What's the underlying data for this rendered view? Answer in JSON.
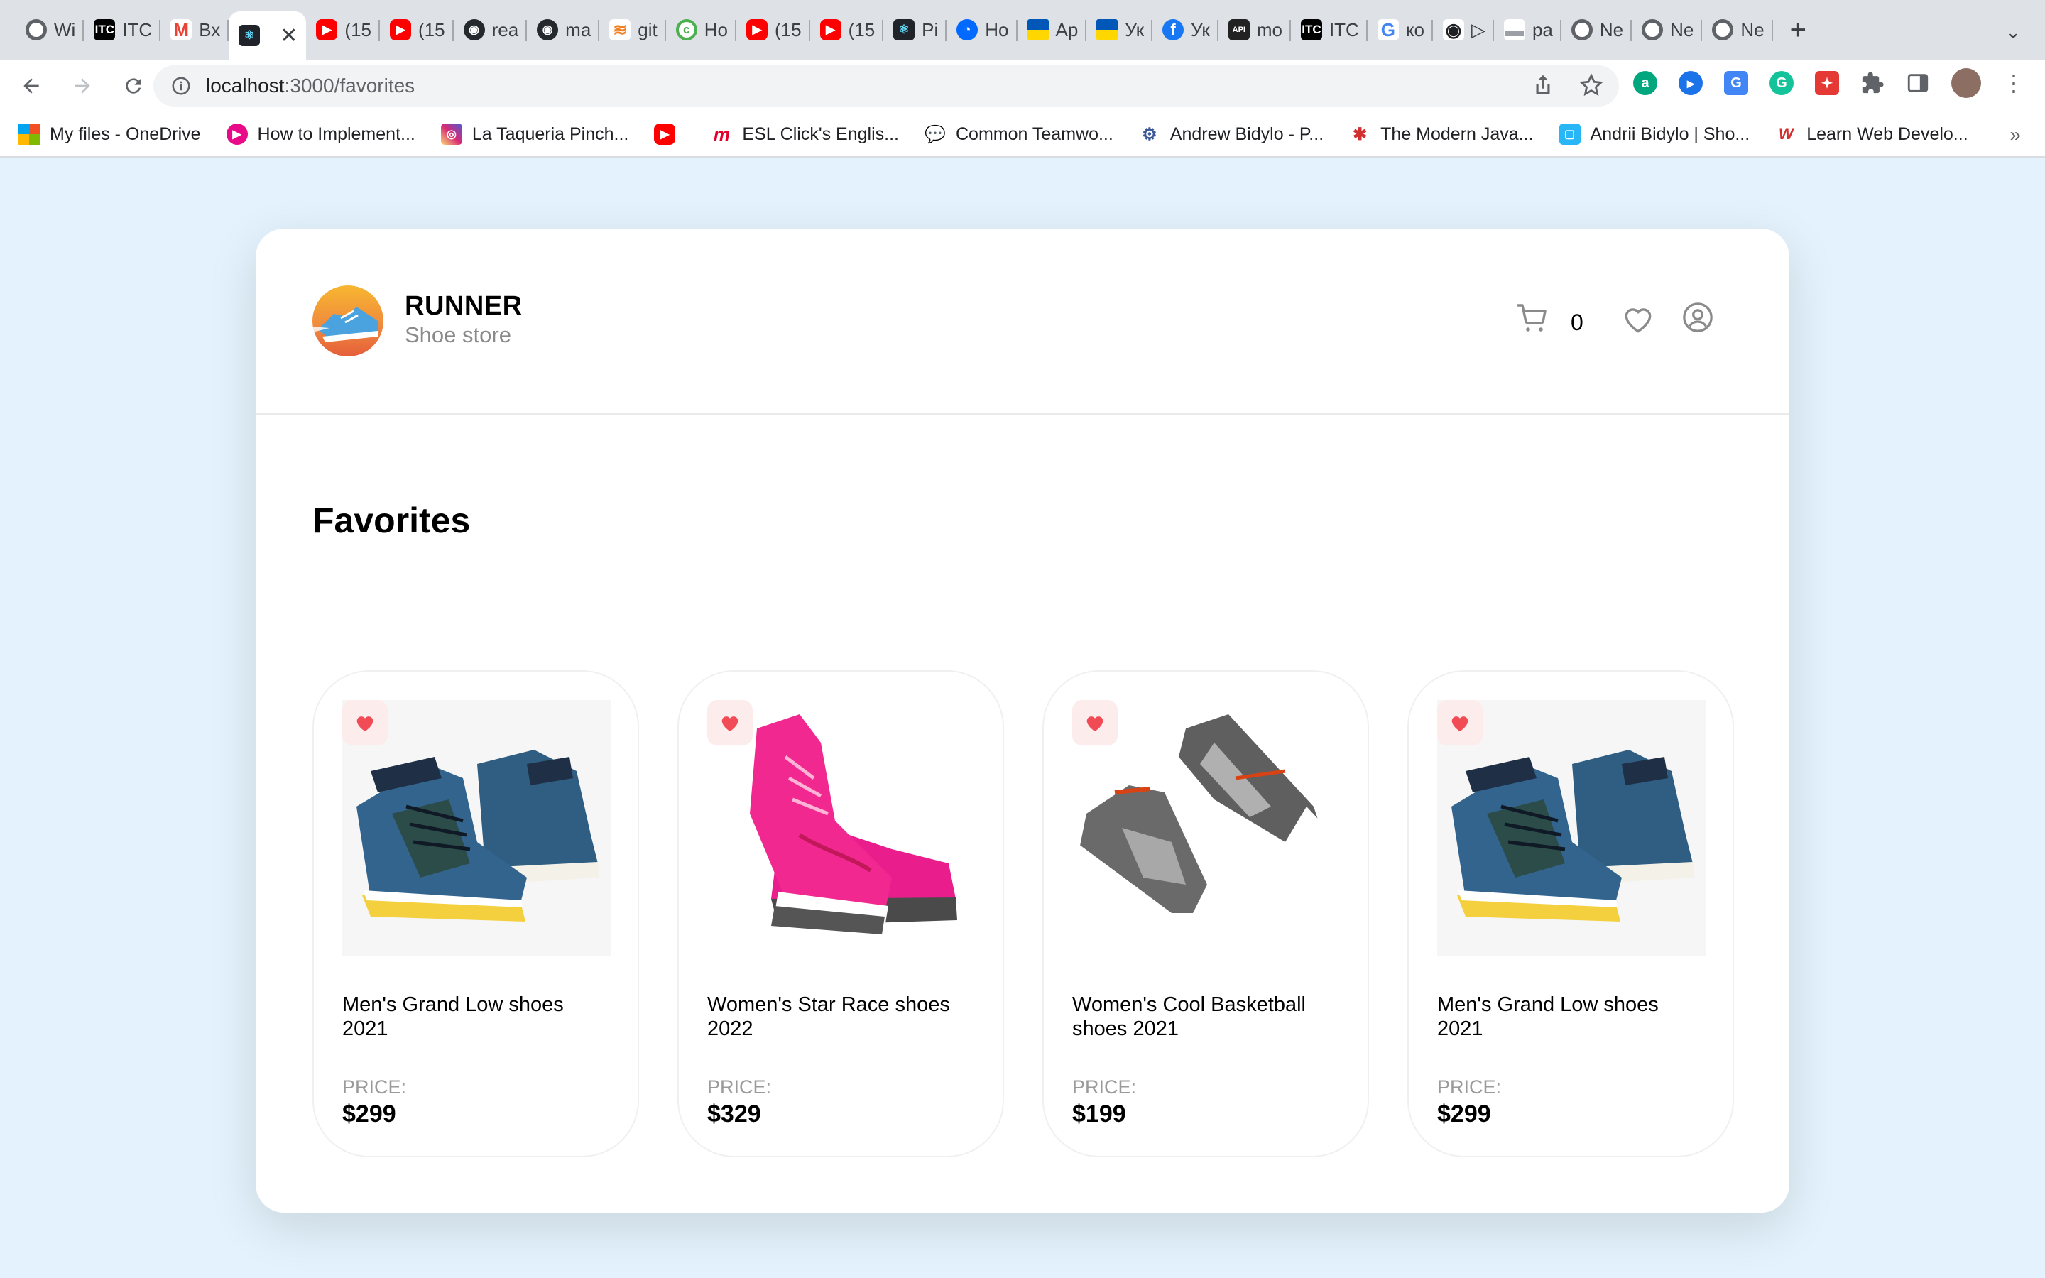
{
  "browser": {
    "tabs": [
      {
        "title": "Wi",
        "icon": "chrome-icon",
        "color": "#5f6368"
      },
      {
        "title": "ITC",
        "icon": "itc-icon",
        "color": "#000000"
      },
      {
        "title": "Вх",
        "icon": "gmail-icon",
        "color": "#ea4335"
      },
      {
        "title": "",
        "icon": "react-icon",
        "color": "#20232a",
        "active": true
      },
      {
        "title": "(15",
        "icon": "youtube-icon",
        "color": "#ff0000"
      },
      {
        "title": "(15",
        "icon": "youtube-icon",
        "color": "#ff0000"
      },
      {
        "title": "rea",
        "icon": "github-icon",
        "color": "#24292e"
      },
      {
        "title": "ma",
        "icon": "github-icon",
        "color": "#24292e"
      },
      {
        "title": "git",
        "icon": "stackoverflow-icon",
        "color": "#f48024"
      },
      {
        "title": "Ho",
        "icon": "chromatic-icon",
        "color": "#4caf50"
      },
      {
        "title": "(15",
        "icon": "youtube-icon",
        "color": "#ff0000"
      },
      {
        "title": "(15",
        "icon": "youtube-icon",
        "color": "#ff0000"
      },
      {
        "title": "Pi",
        "icon": "react-icon",
        "color": "#20232a"
      },
      {
        "title": "Ho",
        "icon": "digitalocean-icon",
        "color": "#0069ff"
      },
      {
        "title": "Ap",
        "icon": "ukraine-flag-icon",
        "color": "#0057b7"
      },
      {
        "title": "Ук",
        "icon": "ukraine-flag-icon",
        "color": "#0057b7"
      },
      {
        "title": "Ук",
        "icon": "facebook-icon",
        "color": "#1877f2"
      },
      {
        "title": "mo",
        "icon": "mockapi-icon",
        "color": "#222222"
      },
      {
        "title": "ITC",
        "icon": "itc-icon",
        "color": "#000000"
      },
      {
        "title": "ко",
        "icon": "google-icon",
        "color": "#4285f4"
      },
      {
        "title": "▷",
        "icon": "location-icon",
        "color": "#202124"
      },
      {
        "title": "pa",
        "icon": "bar-icon",
        "color": "#9aa0a6"
      },
      {
        "title": "Ne",
        "icon": "chrome-icon",
        "color": "#5f6368"
      },
      {
        "title": "Ne",
        "icon": "chrome-icon",
        "color": "#5f6368"
      },
      {
        "title": "Ne",
        "icon": "chrome-icon",
        "color": "#5f6368"
      }
    ],
    "url_host": "localhost",
    "url_path": ":3000/favorites",
    "bookmarks": [
      {
        "label": "My files - OneDrive",
        "icon": "microsoft-icon",
        "color": "#f25022"
      },
      {
        "label": "How to Implement...",
        "icon": "pluralsight-icon",
        "color": "#e80a89"
      },
      {
        "label": "La Taqueria Pinch...",
        "icon": "instagram-icon",
        "color": "#c13584"
      },
      {
        "label": "",
        "icon": "youtube-icon",
        "color": "#ff0000"
      },
      {
        "label": "ESL Click's Englis...",
        "icon": "esl-icon",
        "color": "#e4002b"
      },
      {
        "label": "Common Teamwo...",
        "icon": "chat-icon",
        "color": "#5f6368"
      },
      {
        "label": "Andrew Bidylo - P...",
        "icon": "profile-icon",
        "color": "#3b5998"
      },
      {
        "label": "The Modern Java...",
        "icon": "js-icon",
        "color": "#d32f2f"
      },
      {
        "label": "Andrii Bidylo | Sho...",
        "icon": "portfolio-icon",
        "color": "#29b6f6"
      },
      {
        "label": "Learn Web Develo...",
        "icon": "webdev-icon",
        "color": "#d32f2f"
      }
    ]
  },
  "app": {
    "brand_title": "RUNNER",
    "brand_subtitle": "Shoe store",
    "cart_count": "0",
    "page_title": "Favorites",
    "price_label": "PRICE:",
    "accent": "#f14c56",
    "products": [
      {
        "name": "Men's Grand Low shoes 2021",
        "price": "$299",
        "image": "blue-high-top-sneakers"
      },
      {
        "name": "Women's Star Race shoes 2022",
        "price": "$329",
        "image": "pink-running-shoes"
      },
      {
        "name": "Women's Cool Basketball shoes 2021",
        "price": "$199",
        "image": "grey-basketball-shoes"
      },
      {
        "name": "Men's Grand Low shoes 2021",
        "price": "$299",
        "image": "blue-high-top-sneakers"
      }
    ]
  }
}
